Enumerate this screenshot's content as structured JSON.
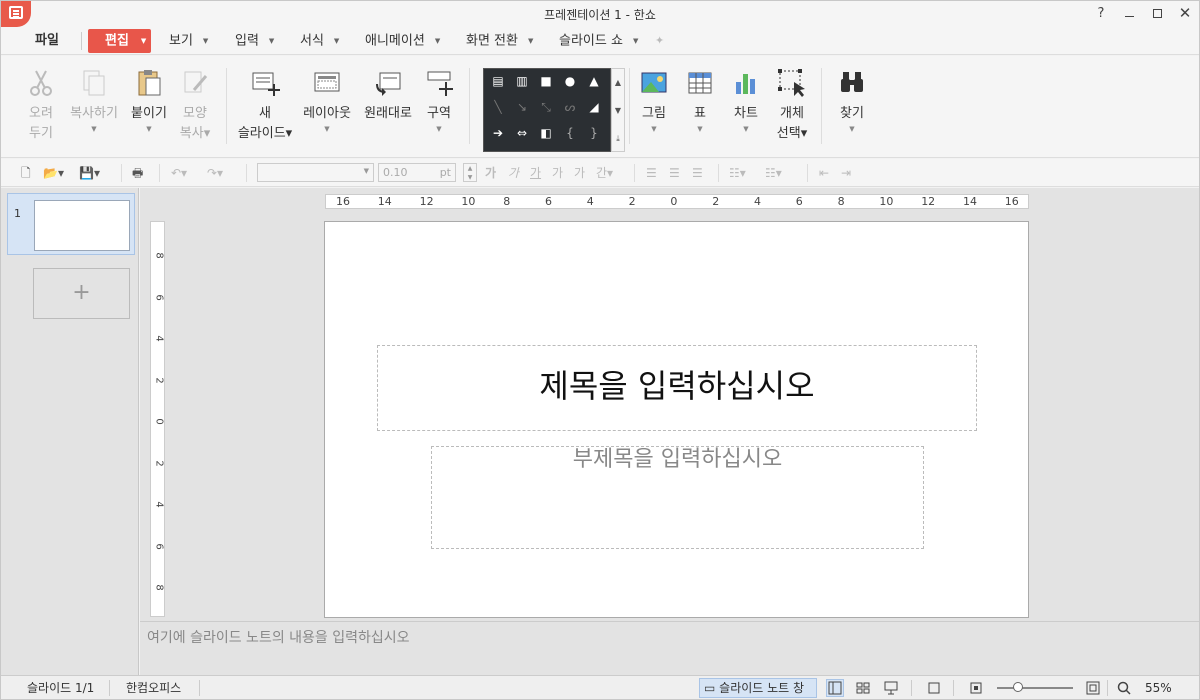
{
  "window": {
    "title": "프레젠테이션 1 - 한쇼",
    "help": "?"
  },
  "menu": {
    "file": "파일",
    "edit": "편집",
    "items": [
      "보기",
      "입력",
      "서식",
      "애니메이션",
      "화면 전환",
      "슬라이드 쇼"
    ]
  },
  "ribbon": {
    "cut": [
      "오려",
      "두기"
    ],
    "copy": "복사하기",
    "paste": "붙이기",
    "format_copy": [
      "모양",
      "복사"
    ],
    "new_slide": [
      "새",
      "슬라이드"
    ],
    "layout": "레이아웃",
    "reset": "원래대로",
    "section": "구역",
    "picture": "그림",
    "table": "표",
    "chart": "차트",
    "select_object": [
      "개체",
      "선택"
    ],
    "find": "찾기"
  },
  "quick_toolbar": {
    "font_size": "0.10",
    "font_unit": "pt",
    "char_styles": [
      "가",
      "가",
      "가",
      "가",
      "가",
      "간"
    ]
  },
  "slides_panel": {
    "slide_number": "1"
  },
  "ruler": {
    "horizontal": [
      "16",
      "14",
      "12",
      "10",
      "8",
      "6",
      "4",
      "2",
      "0",
      "2",
      "4",
      "6",
      "8",
      "10",
      "12",
      "14",
      "16"
    ],
    "vertical": [
      "8",
      "6",
      "4",
      "2",
      "0",
      "2",
      "4",
      "6",
      "8"
    ]
  },
  "slide": {
    "title_placeholder": "제목을 입력하십시오",
    "subtitle_placeholder": "부제목을 입력하십시오"
  },
  "notes": {
    "placeholder": "여기에 슬라이드 노트의 내용을 입력하십시오"
  },
  "status": {
    "slide_position": "슬라이드 1/1",
    "theme": "한컴오피스",
    "notes_pane": "슬라이드 노트 창",
    "zoom": "55%"
  },
  "colors": {
    "accent": "#e8564a",
    "selection": "#d6e4f5",
    "gallery_bg": "#2b2f33"
  }
}
